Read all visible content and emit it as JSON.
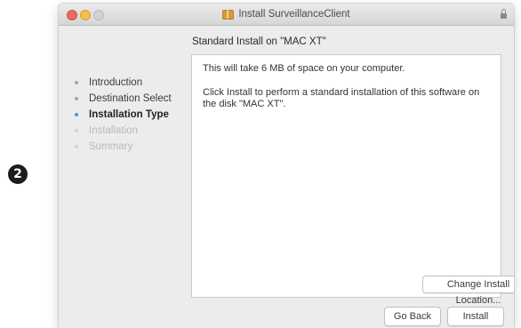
{
  "step_badge": "2",
  "window": {
    "title": "Install SurveillanceClient",
    "pane_heading": "Standard Install on \"MAC XT\""
  },
  "sidebar": {
    "steps": [
      {
        "label": "Introduction",
        "state": "done"
      },
      {
        "label": "Destination Select",
        "state": "done"
      },
      {
        "label": "Installation Type",
        "state": "current"
      },
      {
        "label": "Installation",
        "state": "pending"
      },
      {
        "label": "Summary",
        "state": "pending"
      }
    ]
  },
  "content": {
    "space_message": "This will take 6 MB of space on your computer.",
    "instruction": "Click Install to perform a standard installation of this software on the disk \"MAC XT\"."
  },
  "buttons": {
    "change_location": "Change Install Location...",
    "go_back": "Go Back",
    "install": "Install"
  },
  "colors": {
    "close": "#ed6a5e",
    "minimize": "#f5bf4f",
    "zoom_disabled": "#d2d2d2",
    "current_step_dot": "#4a8fe2",
    "window_background": "#ececec"
  },
  "icons": {
    "title": "package-icon",
    "titlebar_right": "lock-icon"
  }
}
